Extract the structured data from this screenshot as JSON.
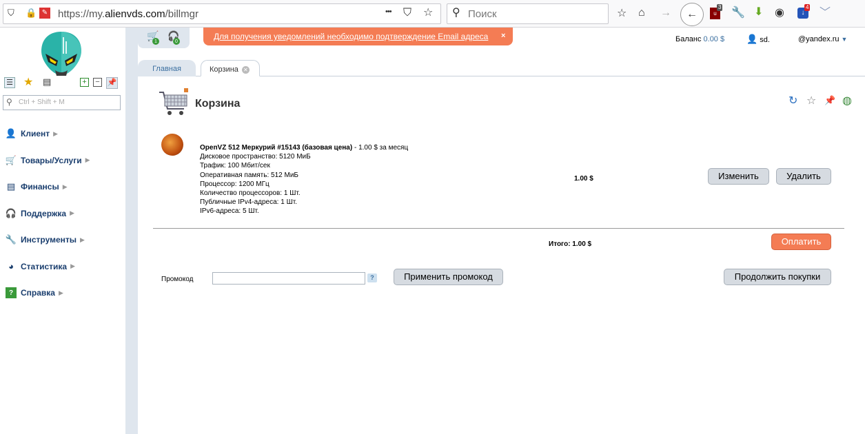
{
  "browser": {
    "url_prefix": "https://my.",
    "url_domain": "alienvds.com",
    "url_path": "/billmgr",
    "search_placeholder": "Поиск",
    "ublock_count": "3",
    "ext_count": "4",
    "more_icon": "•••"
  },
  "header": {
    "cart_count": "1",
    "support_count": "0",
    "notice": "Для получения уведомлений необходимо подтверждение Email адреса",
    "notice_close": "×",
    "balance_label": "Баланс",
    "balance_value": "0.00 $",
    "user_name": "sd.",
    "email": "@yandex.ru"
  },
  "sidebar": {
    "search_placeholder": "Ctrl + Shift + M",
    "items": [
      {
        "label": "Клиент"
      },
      {
        "label": "Товары/Услуги"
      },
      {
        "label": "Финансы"
      },
      {
        "label": "Поддержка"
      },
      {
        "label": "Инструменты"
      },
      {
        "label": "Статистика"
      },
      {
        "label": "Справка"
      }
    ]
  },
  "tabs": {
    "main": "Главная",
    "cart": "Корзина"
  },
  "page": {
    "title": "Корзина",
    "item": {
      "name": "OpenVZ 512 Меркурий #15143 (базовая цена)",
      "price_suffix": " - 1.00 $ за месяц",
      "specs": [
        "Дисковое пространство: 5120 МиБ",
        "Трафик: 100 Мбит/сек",
        "Оперативная память: 512 МиБ",
        "Процессор: 1200 МГц",
        "Количество процессоров: 1 Шт.",
        "Публичные IPv4-адреса: 1 Шт.",
        "IPv6-адреса: 5 Шт."
      ],
      "price": "1.00 $"
    },
    "edit_button": "Изменить",
    "delete_button": "Удалить",
    "total": "Итого: 1.00 $",
    "pay_button": "Оплатить",
    "promo_label": "Промокод",
    "promo_value": "",
    "promo_help": "?",
    "apply_promo_button": "Применить промокод",
    "continue_button": "Продолжить покупки"
  }
}
